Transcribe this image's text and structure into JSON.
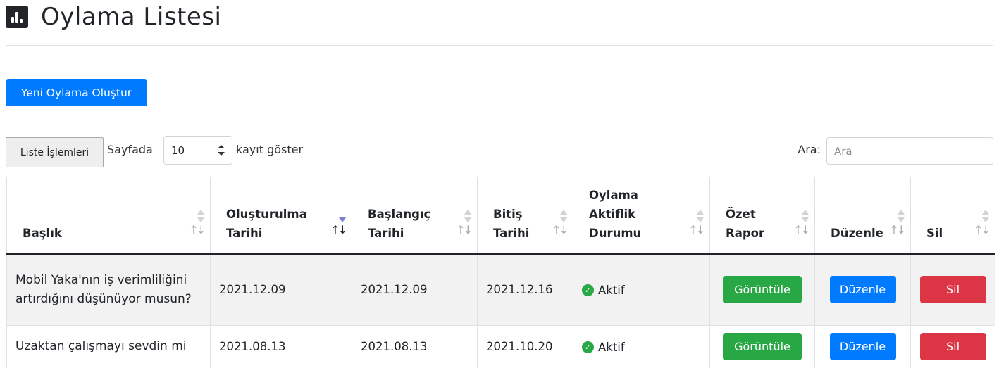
{
  "page": {
    "title": "Oylama Listesi",
    "title_icon": "bar-chart-icon"
  },
  "actions": {
    "new_poll": "Yeni Oylama Oluştur"
  },
  "toolbar": {
    "list_actions": "Liste İşlemleri",
    "per_page_prefix": "Sayfada",
    "per_page_value": "10",
    "per_page_suffix": "kayıt göster",
    "search_label": "Ara:",
    "search_placeholder": "Ara"
  },
  "table": {
    "columns": [
      [
        "Başlık"
      ],
      [
        "Oluşturulma",
        "Tarihi"
      ],
      [
        "Başlangıç",
        "Tarihi"
      ],
      [
        "Bitiş",
        "Tarihi"
      ],
      [
        "Oylama",
        "Aktiflik",
        "Durumu"
      ],
      [
        "Özet",
        "Rapor"
      ],
      [
        "Düzenle"
      ],
      [
        "Sil"
      ]
    ],
    "sort_active_column": 1,
    "rows": [
      {
        "title": "Mobil Yaka'nın iş verimliliğini artırdığını düşünüyor musun?",
        "created": "2021.12.09",
        "start": "2021.12.09",
        "end": "2021.12.16",
        "status": "Aktif",
        "report_btn": "Görüntüle",
        "edit_btn": "Düzenle",
        "delete_btn": "Sil"
      },
      {
        "title": "Uzaktan çalışmayı sevdin mi",
        "created": "2021.08.13",
        "start": "2021.08.13",
        "end": "2021.10.20",
        "status": "Aktif",
        "report_btn": "Görüntüle",
        "edit_btn": "Düzenle",
        "delete_btn": "Sil"
      }
    ]
  },
  "colors": {
    "primary": "#007bff",
    "success": "#28a745",
    "danger": "#dc3545",
    "sort_active": "#7f7fd5"
  }
}
